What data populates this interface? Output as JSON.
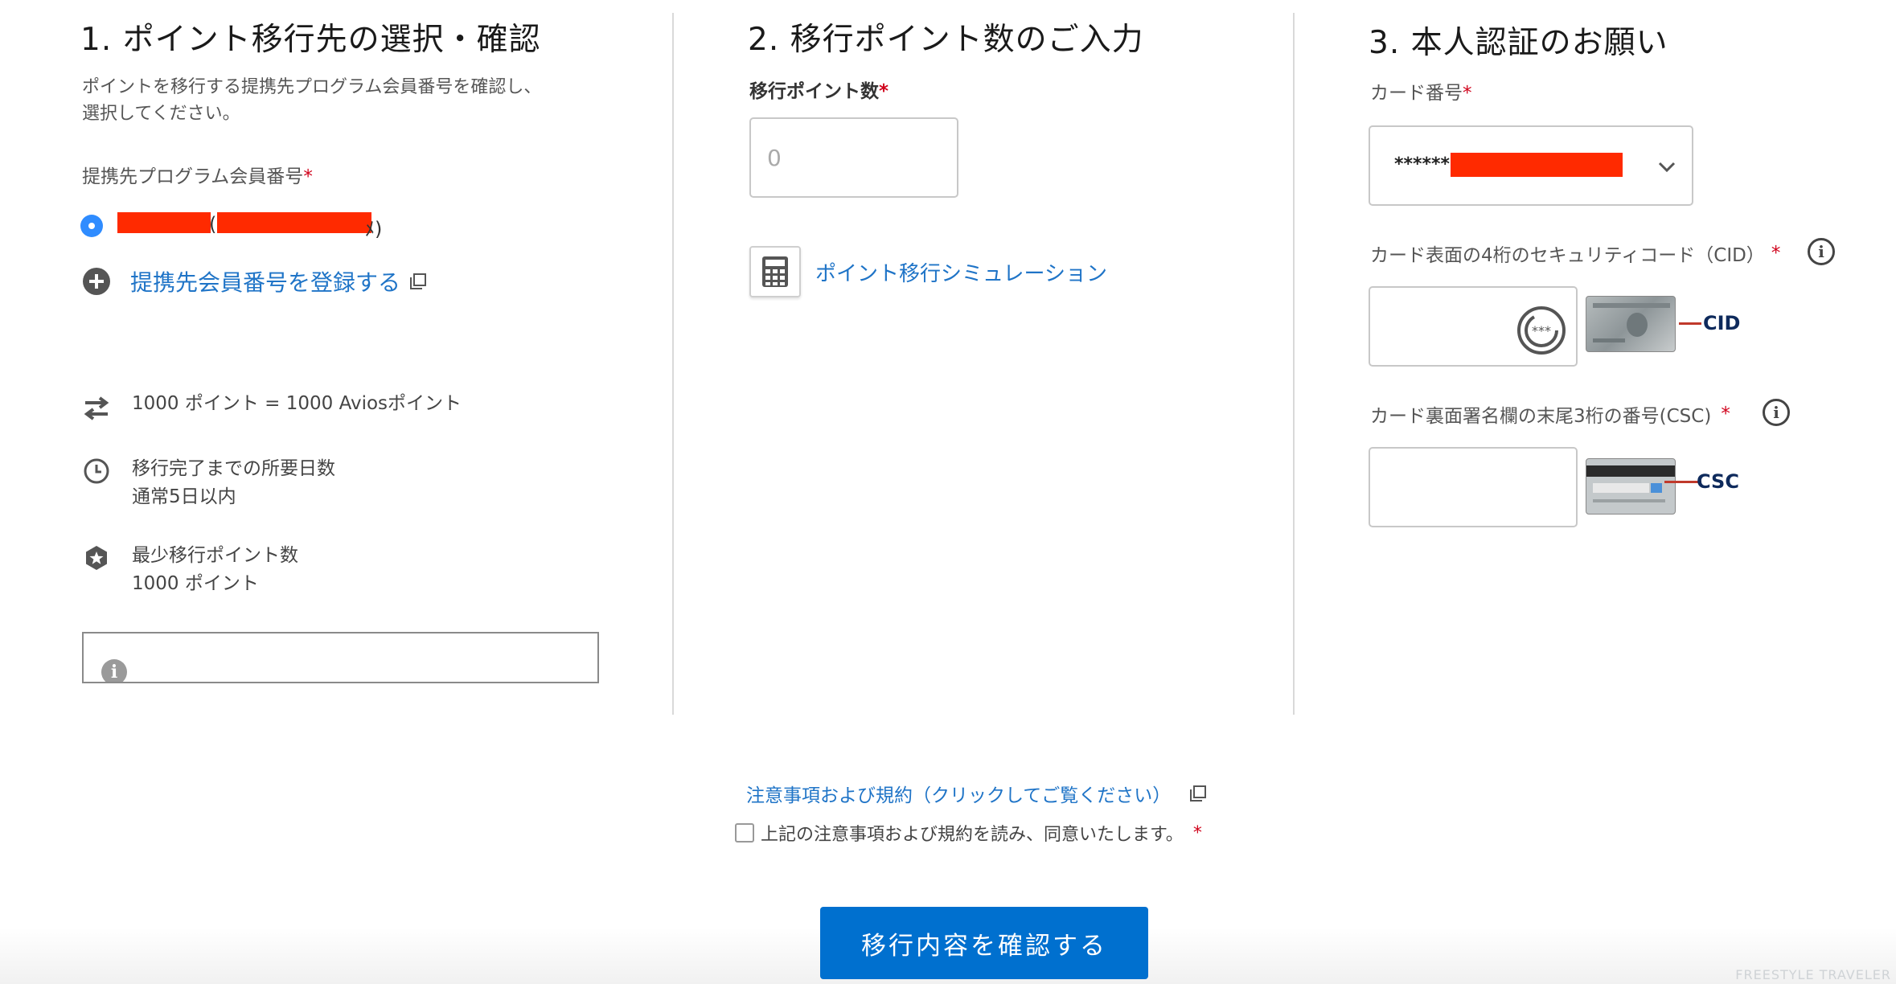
{
  "col1": {
    "heading": "1. ポイント移行先の選択・確認",
    "desc_line1": "ポイントを移行する提携先プログラム会員番号を確認し、",
    "desc_line2": "選択してください。",
    "member_label": "提携先プログラム会員番号",
    "required_mark": "*",
    "member_suffix_left": "(",
    "member_suffix_right": "ﾒ)",
    "register_link": "提携先会員番号を登録する",
    "rate": "1000 ポイント = 1000 Aviosポイント",
    "days_title": "移行完了までの所要日数",
    "days_value": "通常5日以内",
    "min_title": "最少移行ポイント数",
    "min_value": "1000 ポイント"
  },
  "col2": {
    "heading": "2. 移行ポイント数のご入力",
    "points_label": "移行ポイント数",
    "required_mark": "*",
    "points_placeholder": "0",
    "simulation_link": "ポイント移行シミュレーション"
  },
  "col3": {
    "heading": "3. 本人認証のお願い",
    "card_label": "カード番号",
    "required_mark": "*",
    "card_masked": "******",
    "cid_label": "カード表面の4桁のセキュリティコード（CID）",
    "cid_badge": "CID",
    "csc_label": "カード裏面署名欄の末尾3桁の番号(CSC)",
    "csc_badge": "CSC",
    "dots": "***"
  },
  "footer": {
    "terms_link": "注意事項および規約（クリックしてご覧ください）",
    "agree_label": "上記の注意事項および規約を読み、同意いたします。",
    "required_mark": "*",
    "confirm_button": "移行内容を確認する",
    "watermark": "FREESTYLE TRAVELER"
  },
  "colors": {
    "link": "#1f74c7",
    "button": "#0070cf",
    "required": "#d0021b",
    "redaction": "#ff2a00",
    "radio": "#2f8cff"
  },
  "icons": [
    "exchange-icon",
    "clock-icon",
    "star-badge-icon",
    "info-icon",
    "plus-circle-icon",
    "external-link-icon",
    "calculator-icon",
    "chevron-down-icon",
    "card-front-image",
    "card-back-image"
  ]
}
